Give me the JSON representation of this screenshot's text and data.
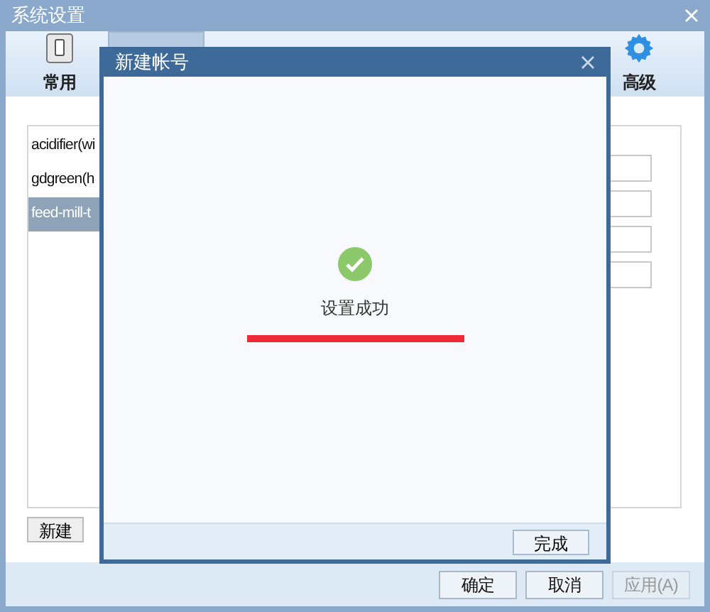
{
  "window": {
    "title": "系统设置"
  },
  "toolbar_tabs": [
    {
      "label": "常用",
      "selected": false
    },
    {
      "selected": true
    },
    {
      "selected": false
    },
    {
      "selected": false
    },
    {
      "selected": false
    },
    {
      "selected": false
    },
    {
      "label": "高级",
      "selected": false
    }
  ],
  "accounts": [
    {
      "label": "acidifier(wi",
      "selected": false
    },
    {
      "label": "gdgreen(h",
      "selected": false
    },
    {
      "label": "feed-mill-t",
      "selected": true
    }
  ],
  "list_buttons": [
    "新建"
  ],
  "dialog": {
    "title": "新建帐号",
    "message": "设置成功",
    "button": "完成"
  },
  "footer_buttons": [
    {
      "label": "确定",
      "disabled": false
    },
    {
      "label": "取消",
      "disabled": false
    },
    {
      "label": "应用(A)",
      "disabled": true
    }
  ]
}
